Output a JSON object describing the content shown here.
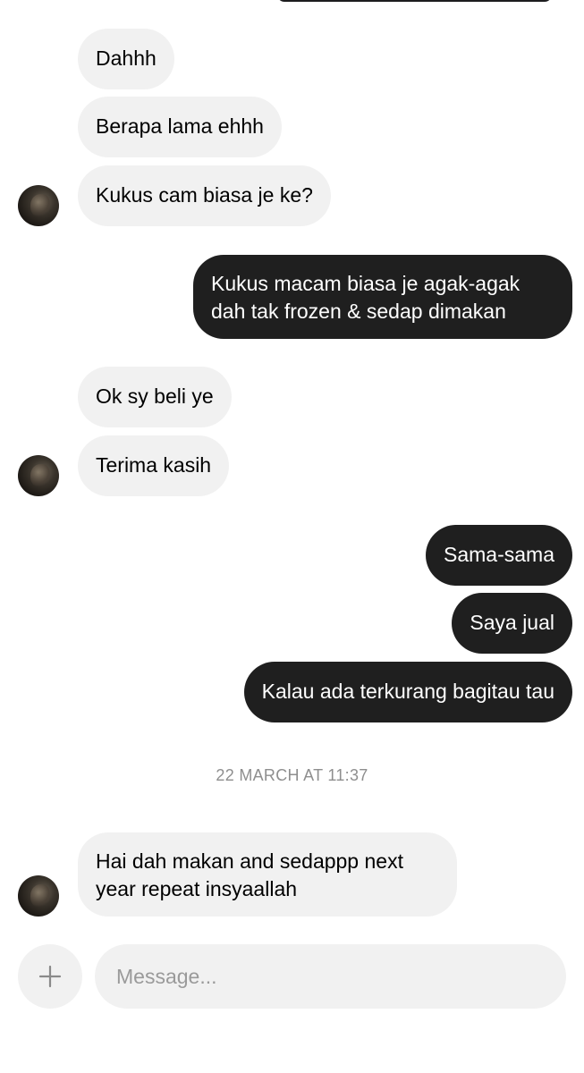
{
  "thread": {
    "messages": [
      {
        "from": "them",
        "text": "Dahhh"
      },
      {
        "from": "them",
        "text": "Berapa lama ehhh"
      },
      {
        "from": "them",
        "text": "Kukus cam biasa je ke?"
      },
      {
        "from": "me",
        "text": "Kukus macam biasa je agak-agak dah tak frozen & sedap dimakan"
      },
      {
        "from": "them",
        "text": "Ok sy beli ye"
      },
      {
        "from": "them",
        "text": "Terima kasih"
      },
      {
        "from": "me",
        "text": "Sama-sama"
      },
      {
        "from": "me",
        "text": "Saya jual"
      },
      {
        "from": "me",
        "text": "Kalau ada terkurang bagitau tau"
      },
      {
        "from": "them",
        "text": "Hai dah makan and sedappp next year repeat insyaallah"
      }
    ],
    "timestamp": "22 MARCH AT 11:37"
  },
  "composer": {
    "add_icon": "plus-icon",
    "placeholder": "Message...",
    "value": ""
  },
  "colors": {
    "incoming_bubble": "#f1f1f1",
    "outgoing_bubble": "#1f1f1f",
    "timestamp_text": "#8e8e8e",
    "placeholder_text": "#9a9a9a"
  }
}
